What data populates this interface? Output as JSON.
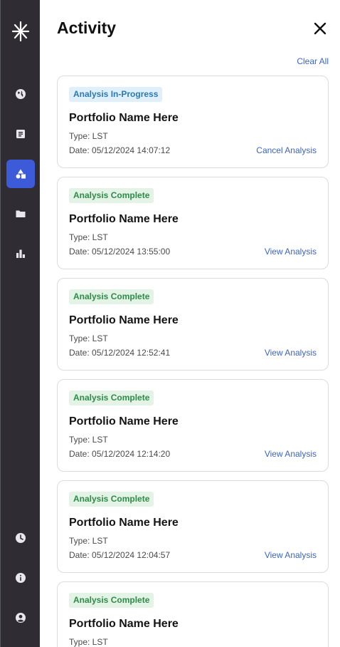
{
  "nav": {
    "items": [
      {
        "icon": "globe-icon",
        "active": false
      },
      {
        "icon": "document-icon",
        "active": false
      },
      {
        "icon": "shapes-icon",
        "active": true
      },
      {
        "icon": "folder-icon",
        "active": false
      },
      {
        "icon": "bar-chart-icon",
        "active": false
      },
      {
        "icon": "clock-icon",
        "active": false
      },
      {
        "icon": "info-icon",
        "active": false
      },
      {
        "icon": "account-icon",
        "active": false
      }
    ],
    "active_color": "#3d5bd9",
    "background": "#2f2d33"
  },
  "panel": {
    "title": "Activity",
    "clear_label": "Clear All"
  },
  "activities": [
    {
      "status": "Analysis In-Progress",
      "status_kind": "in-progress",
      "name": "Portfolio Name Here",
      "type": "Type: LST",
      "date": "Date: 05/12/2024 14:07:12",
      "action": "Cancel Analysis"
    },
    {
      "status": "Analysis Complete",
      "status_kind": "complete",
      "name": "Portfolio Name Here",
      "type": "Type: LST",
      "date": "Date: 05/12/2024 13:55:00",
      "action": "View Analysis"
    },
    {
      "status": "Analysis Complete",
      "status_kind": "complete",
      "name": "Portfolio Name Here",
      "type": "Type: LST",
      "date": "Date: 05/12/2024 12:52:41",
      "action": "View Analysis"
    },
    {
      "status": "Analysis Complete",
      "status_kind": "complete",
      "name": "Portfolio Name Here",
      "type": "Type: LST",
      "date": "Date: 05/12/2024 12:14:20",
      "action": "View Analysis"
    },
    {
      "status": "Analysis Complete",
      "status_kind": "complete",
      "name": "Portfolio Name Here",
      "type": "Type: LST",
      "date": "Date: 05/12/2024 12:04:57",
      "action": "View Analysis"
    },
    {
      "status": "Analysis Complete",
      "status_kind": "complete",
      "name": "Portfolio Name Here",
      "type": "Type: LST",
      "date": "",
      "action": ""
    }
  ],
  "colors": {
    "link": "#3a64c8",
    "in_progress_badge": "#e0f0fa",
    "complete_badge": "#e3f4e6"
  }
}
